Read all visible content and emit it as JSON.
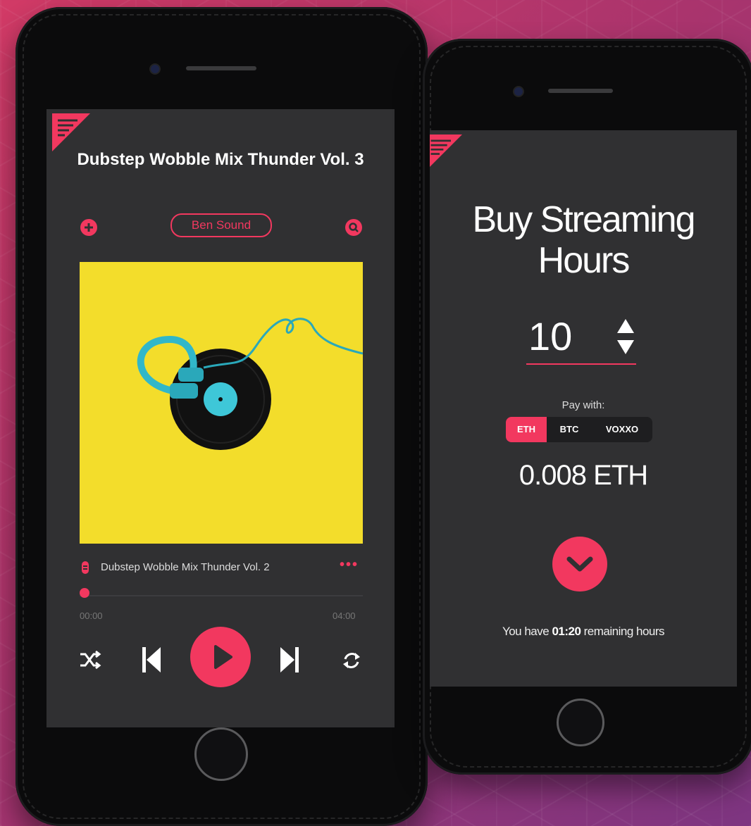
{
  "player": {
    "track_title": "Dubstep Wobble Mix Thunder Vol. 3",
    "artist": "Ben Sound",
    "now_playing": "Dubstep Wobble Mix Thunder Vol. 2",
    "more_label": "•••",
    "current_time": "00:00",
    "total_time": "04:00",
    "progress": 0.0,
    "icons": [
      "menu-logo-icon",
      "add-icon",
      "search-icon",
      "music-note-icon",
      "more-icon",
      "shuffle-icon",
      "previous-icon",
      "play-icon",
      "next-icon",
      "repeat-icon"
    ]
  },
  "purchase": {
    "title": "Buy Streaming Hours",
    "quantity": "10",
    "pay_with_label": "Pay with:",
    "currencies": [
      "ETH",
      "BTC",
      "VOXXO"
    ],
    "selected_currency": "ETH",
    "amount": "0.008 ETH",
    "remaining_prefix": "You have ",
    "remaining_value": "01:20",
    "remaining_suffix": " remaining hours"
  },
  "colors": {
    "accent": "#f2385f",
    "screen_bg": "#303032",
    "phone_body": "#0b0b0c"
  }
}
